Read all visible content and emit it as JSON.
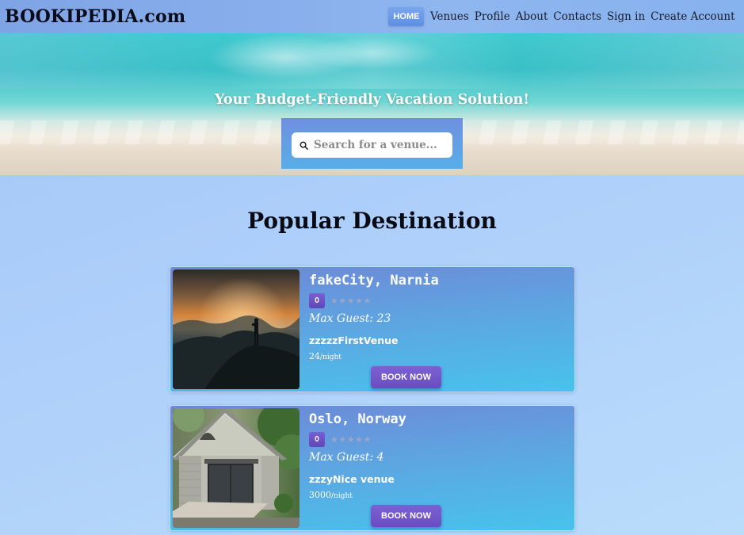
{
  "navbar": {
    "brand": "BOOKIPEDIA.com",
    "links": [
      "HOME",
      "Venues",
      "Profile",
      "About",
      "Contacts",
      "Sign in",
      "Create Account"
    ]
  },
  "hero": {
    "tagline": "Your Budget-Friendly Vacation Solution!",
    "search_placeholder": "Search for a venue..."
  },
  "section": {
    "title": "Popular Destination"
  },
  "venues": [
    {
      "location": "fakeCity, Narnia",
      "rating_badge": "0",
      "stars": "★★★★★",
      "rating_value": 0,
      "max_guest": "Max Guest: 23",
      "name": "zzzzzFirstVenue",
      "price": "24",
      "price_unit": "/night",
      "button": "BOOK NOW",
      "image": "silhouette-at-sunset-mountain"
    },
    {
      "location": "Oslo, Norway",
      "rating_badge": "0",
      "stars": "★★★★★",
      "rating_value": 0,
      "max_guest": "Max Guest: 4",
      "name": "zzzyNice venue",
      "price": "3000",
      "price_unit": "/night",
      "button": "BOOK NOW",
      "image": "small-cabin-house"
    }
  ],
  "colors": {
    "page_bg": "#aed0fa",
    "card_top": "#6f87d6",
    "card_bottom": "#47c3ec",
    "button": "#7c61d4"
  }
}
